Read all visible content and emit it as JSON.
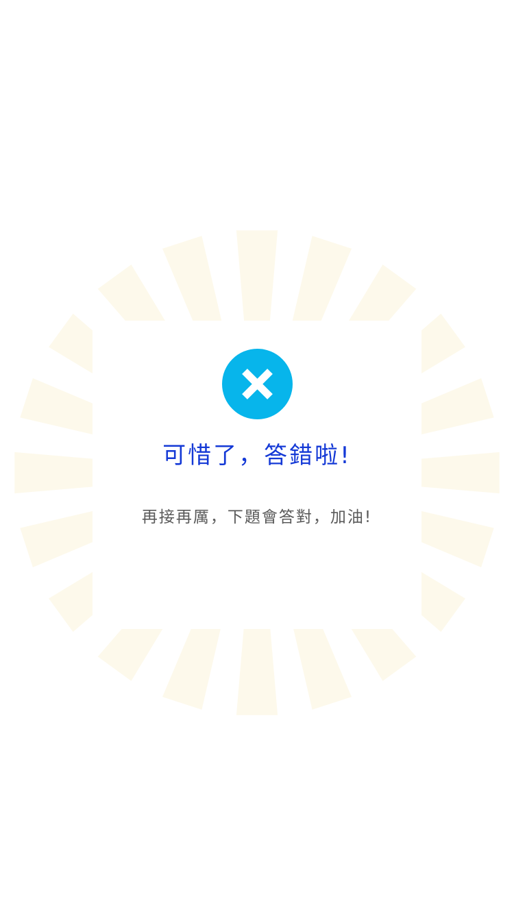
{
  "result": {
    "title": "可惜了，答錯啦!",
    "message": "再接再厲，下題會答對，加油!",
    "status_icon": "close-icon"
  },
  "colors": {
    "background": "#ffffff",
    "icon_background": "#07b5eb",
    "icon_cross": "#ffffff",
    "title": "#1439d6",
    "message": "#5a5a5a",
    "rays": "#f7e2a6"
  }
}
